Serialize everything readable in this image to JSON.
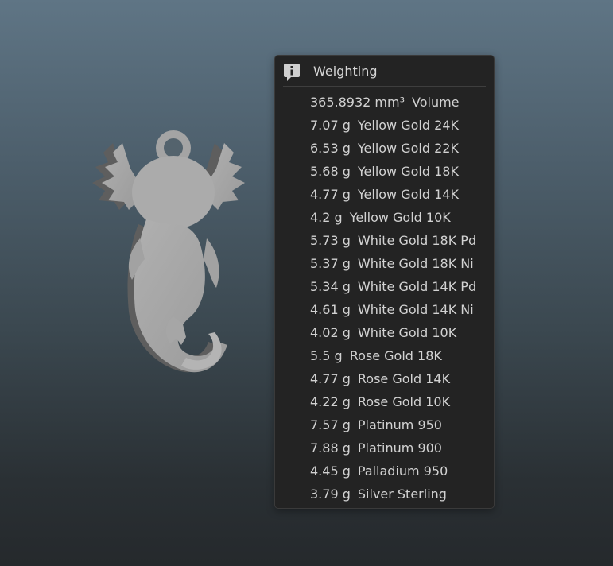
{
  "popup": {
    "icon": "info-icon",
    "title": "Weighting",
    "rows": [
      {
        "value": "365.8932 mm³",
        "label": "Volume"
      },
      {
        "value": "7.07 g",
        "label": "Yellow Gold 24K"
      },
      {
        "value": "6.53 g",
        "label": "Yellow Gold 22K"
      },
      {
        "value": "5.68 g",
        "label": "Yellow Gold 18K"
      },
      {
        "value": "4.77 g",
        "label": "Yellow Gold 14K"
      },
      {
        "value": "4.2 g",
        "label": "Yellow Gold 10K"
      },
      {
        "value": "5.73 g",
        "label": "White Gold 18K Pd"
      },
      {
        "value": "5.37 g",
        "label": "White Gold 18K Ni"
      },
      {
        "value": "5.34 g",
        "label": "White Gold 14K Pd"
      },
      {
        "value": "4.61 g",
        "label": "White Gold 14K Ni"
      },
      {
        "value": "4.02 g",
        "label": "White Gold 10K"
      },
      {
        "value": "5.5 g",
        "label": "Rose Gold 18K"
      },
      {
        "value": "4.77 g",
        "label": "Rose Gold 14K"
      },
      {
        "value": "4.22 g",
        "label": "Rose Gold 10K"
      },
      {
        "value": "7.57 g",
        "label": "Platinum 950"
      },
      {
        "value": "7.88 g",
        "label": "Platinum 900"
      },
      {
        "value": "4.45 g",
        "label": "Palladium 950"
      },
      {
        "value": "3.79 g",
        "label": "Silver Sterling"
      }
    ]
  },
  "colors": {
    "viewport_top": "#5f7585",
    "viewport_bottom": "#25292c",
    "popup_bg": "#232323",
    "text": "#d2d2d2",
    "model": "#a9a9a9"
  }
}
